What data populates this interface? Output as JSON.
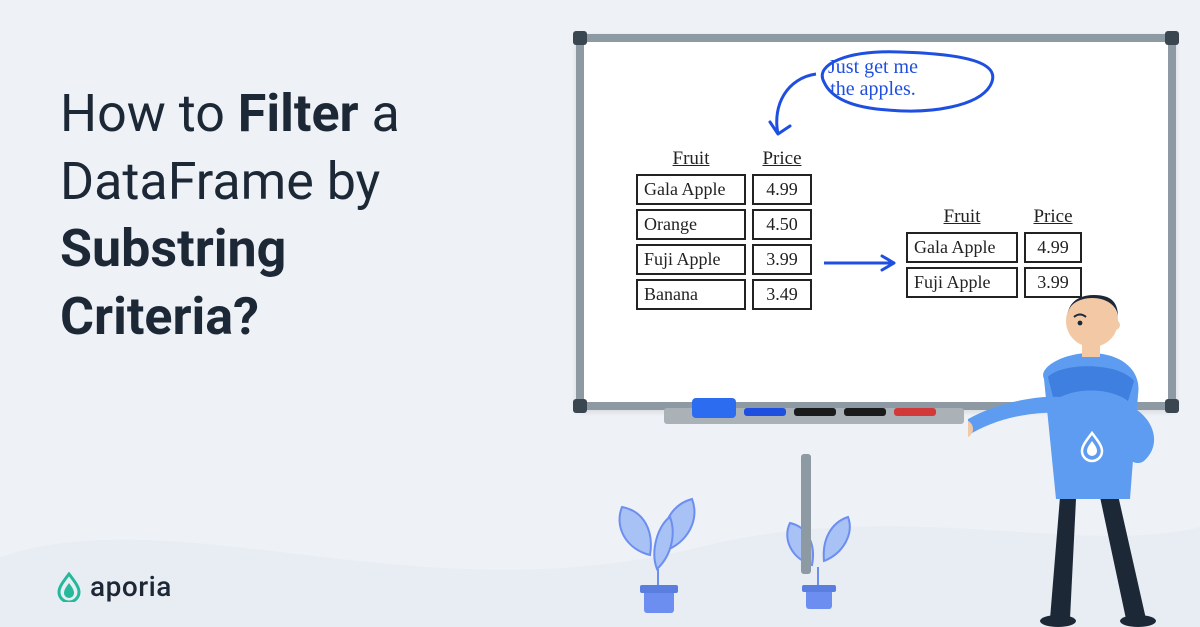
{
  "headline": {
    "l1a": "How to ",
    "l1b": "Filter",
    "l1c": " a",
    "l2": "DataFrame by",
    "l3": "Substring",
    "l4": "Criteria?"
  },
  "logo_text": "aporia",
  "speech": {
    "line1": "Just get me",
    "line2": "the apples."
  },
  "table_left": {
    "cols": [
      "Fruit",
      "Price"
    ],
    "rows": [
      [
        "Gala Apple",
        "4.99"
      ],
      [
        "Orange",
        "4.50"
      ],
      [
        "Fuji Apple",
        "3.99"
      ],
      [
        "Banana",
        "3.49"
      ]
    ]
  },
  "table_right": {
    "cols": [
      "Fruit",
      "Price"
    ],
    "rows": [
      [
        "Gala Apple",
        "4.99"
      ],
      [
        "Fuji Apple",
        "3.99"
      ]
    ]
  },
  "colors": {
    "accent": "#1e4fe0",
    "teal": "#25b89a",
    "frame": "#8e9aa3",
    "bg": "#eef2f7"
  }
}
